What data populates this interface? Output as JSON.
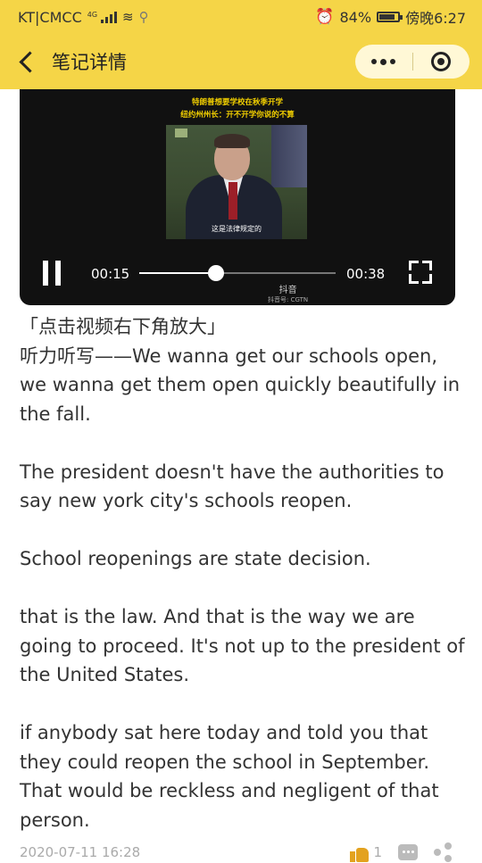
{
  "status_bar": {
    "carrier": "KT|CMCC",
    "network": "4G",
    "battery": "84%",
    "battery_level": 0.84,
    "time": "傍晚6:27"
  },
  "nav": {
    "title": "笔记详情",
    "back_icon": "chevron-left-icon",
    "more_icon": "more-dots-icon",
    "close_icon": "target-close-icon"
  },
  "video": {
    "caption_line1": "特朗普想要学校在秋季开学",
    "caption_line2": "纽约州州长：开不开学你说的不算",
    "subtitle": "这是法律规定的",
    "watermark_app": "抖音",
    "watermark_id": "抖音号: CGTN",
    "current_time": "00:15",
    "duration": "00:38",
    "progress": 0.39
  },
  "article": {
    "paragraphs": [
      "「点击视频右下角放大」\n听力听写——We wanna get our schools open, we wanna get them open quickly beautifully in the fall.",
      "The president doesn't have the authorities to say new york city's schools reopen.",
      "School reopenings are state decision.",
      "that is the law. And that is the way we are going to proceed. It's not up to the president of the United States.",
      "if anybody sat here today and told you that they could reopen the school in September. That would be reckless and negligent of that person."
    ]
  },
  "footer": {
    "date": "2020-07-11 16:28",
    "like_count": "1",
    "accent": "#e3a21f"
  },
  "colors": {
    "header_bg": "#f5d547",
    "capsule_bg": "#fff8d6"
  }
}
